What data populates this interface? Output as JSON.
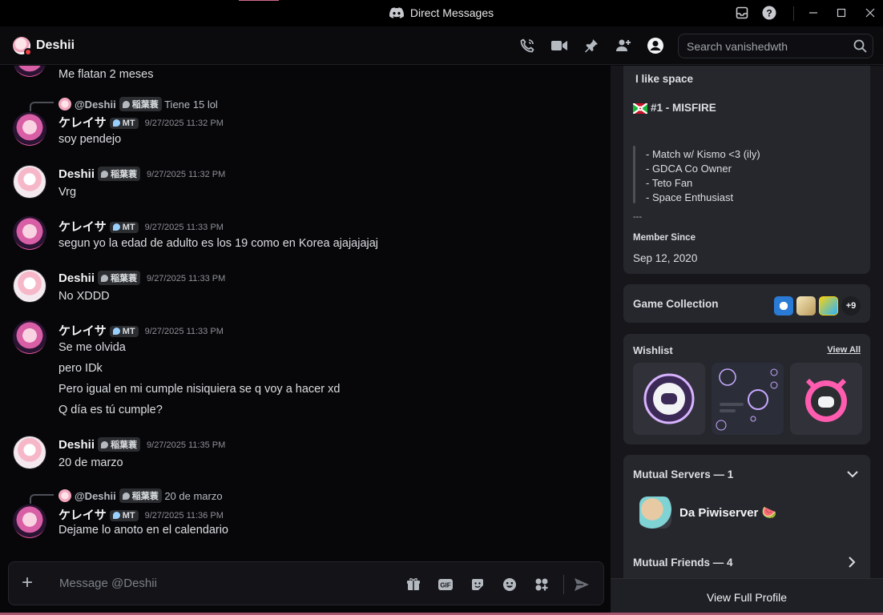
{
  "window": {
    "title": "Direct Messages"
  },
  "header": {
    "name": "Deshii",
    "search_placeholder": "Search vanishedwth"
  },
  "chat": {
    "first_line": "Me flatan 2 meses",
    "messages": [
      {
        "reply_to": "@Deshii",
        "reply_tag": "稲葉蓑",
        "reply_text": "Tiene 15 lol",
        "author": "ケレイサ",
        "tag": "MT",
        "time": "9/27/2025 11:32 PM",
        "lines": [
          "soy pendejo"
        ]
      },
      {
        "author": "Deshii",
        "tag": "稲葉蓑",
        "time": "9/27/2025 11:32 PM",
        "lines": [
          "Vrg"
        ]
      },
      {
        "author": "ケレイサ",
        "tag": "MT",
        "time": "9/27/2025 11:33 PM",
        "lines": [
          "segun yo la edad de adulto es los 19 como en Korea ajajajajaj"
        ]
      },
      {
        "author": "Deshii",
        "tag": "稲葉蓑",
        "time": "9/27/2025 11:33 PM",
        "lines": [
          "No XDDD"
        ]
      },
      {
        "author": "ケレイサ",
        "tag": "MT",
        "time": "9/27/2025 11:33 PM",
        "lines": [
          "Se me olvida",
          "pero IDk",
          "Pero igual en mi cumple nisiquiera se q voy a hacer xd",
          "Q día es tú cumple?"
        ]
      },
      {
        "author": "Deshii",
        "tag": "稲葉蓑",
        "time": "9/27/2025 11:35 PM",
        "lines": [
          "20 de marzo"
        ]
      },
      {
        "reply_to": "@Deshii",
        "reply_tag": "稲葉蓑",
        "reply_text": "20 de marzo",
        "author": "ケレイサ",
        "tag": "MT",
        "time": "9/27/2025 11:36 PM",
        "lines": [
          "Dejame lo anoto en el calendario"
        ]
      }
    ]
  },
  "composer": {
    "placeholder": "Message @Deshii",
    "gif_label": "GIF"
  },
  "profile": {
    "bio": {
      "heading": "I like space",
      "rank": "#1 - MISFIRE",
      "quote": [
        "- Match w/ Kismo <3 (ily)",
        "- GDCA Co Owner",
        "- Teto Fan",
        "- Space Enthusiast"
      ],
      "separator": "---"
    },
    "member_since_label": "Member Since",
    "member_since": "Sep 12, 2020",
    "game_collection_label": "Game Collection",
    "game_more": "+9",
    "wishlist_label": "Wishlist",
    "view_all": "View All",
    "mutual_servers_label": "Mutual Servers — 1",
    "server_name": "Da Piwiserver 🍉",
    "mutual_friends_label": "Mutual Friends — 4",
    "view_full_profile": "View Full Profile"
  }
}
